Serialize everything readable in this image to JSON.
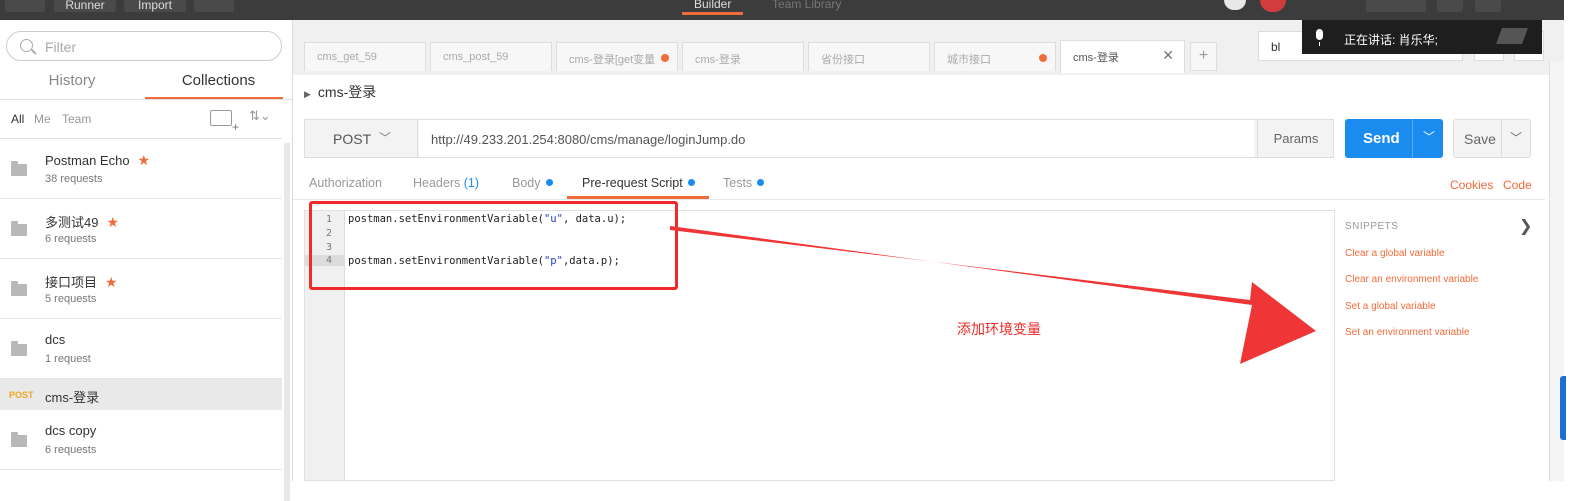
{
  "topbar": {
    "runner_label": "Runner",
    "import_label": "Import",
    "builder_tab": "Builder",
    "team_library_tab": "Team Library"
  },
  "sidebar": {
    "filter_placeholder": "Filter",
    "tabs": [
      "History",
      "Collections"
    ],
    "active_tab": "Collections",
    "scope": [
      "All",
      "Me",
      "Team"
    ],
    "collections": [
      {
        "name": "Postman Echo",
        "count": "38 requests",
        "starred": true
      },
      {
        "name": "多测试49",
        "count": "6 requests",
        "starred": true
      },
      {
        "name": "接口项目",
        "count": "5 requests",
        "starred": true
      },
      {
        "name": "dcs",
        "count": "1 request",
        "starred": false
      }
    ],
    "request_item": {
      "method": "POST",
      "name": "cms-登录"
    },
    "collections_after": [
      {
        "name": "dcs copy",
        "count": "6 requests",
        "starred": false
      }
    ]
  },
  "tabs": [
    {
      "label": "cms_get_59",
      "dot": false
    },
    {
      "label": "cms_post_59",
      "dot": false
    },
    {
      "label": "cms-登录[get变量",
      "dot": true
    },
    {
      "label": "cms-登录",
      "dot": false
    },
    {
      "label": "省份接口",
      "dot": false
    },
    {
      "label": "城市接口",
      "dot": true
    },
    {
      "label": "cms-登录",
      "dot": false,
      "active": true
    }
  ],
  "add_tab_label": "+",
  "environment": {
    "selected": "bl"
  },
  "voice_popup": {
    "text": "正在讲话:  肖乐华;"
  },
  "request": {
    "breadcrumb": "cms-登录",
    "method": "POST",
    "url": "http://49.233.201.254:8080/cms/manage/loginJump.do",
    "params_label": "Params",
    "send_label": "Send",
    "save_label": "Save"
  },
  "subtabs": {
    "authorization": "Authorization",
    "headers": "Headers",
    "headers_count": "(1)",
    "body": "Body",
    "prerequest": "Pre-request Script",
    "tests": "Tests",
    "active": "Pre-request Script",
    "cookies": "Cookies",
    "code": "Code"
  },
  "editor": {
    "line_numbers": [
      "1",
      "2",
      "3",
      "4"
    ],
    "line1": {
      "pre": "postman.setEnvironmentVariable(",
      "str": "\"u\"",
      "post": ", data.u);"
    },
    "line4": {
      "pre": "postman.setEnvironmentVariable(",
      "str": "\"p\"",
      "post": ",data.p);"
    }
  },
  "annotation": {
    "text": "添加环境变量",
    "color": "#ef2a2a"
  },
  "snippets": {
    "title": "SNIPPETS",
    "items": [
      "Clear a global variable",
      "Clear an environment variable",
      "Set a global variable",
      "Set an environment variable"
    ]
  },
  "colors": {
    "accent": "#f26b3a",
    "send_blue": "#1a8cef",
    "annotation_red": "#ef2a2a"
  }
}
